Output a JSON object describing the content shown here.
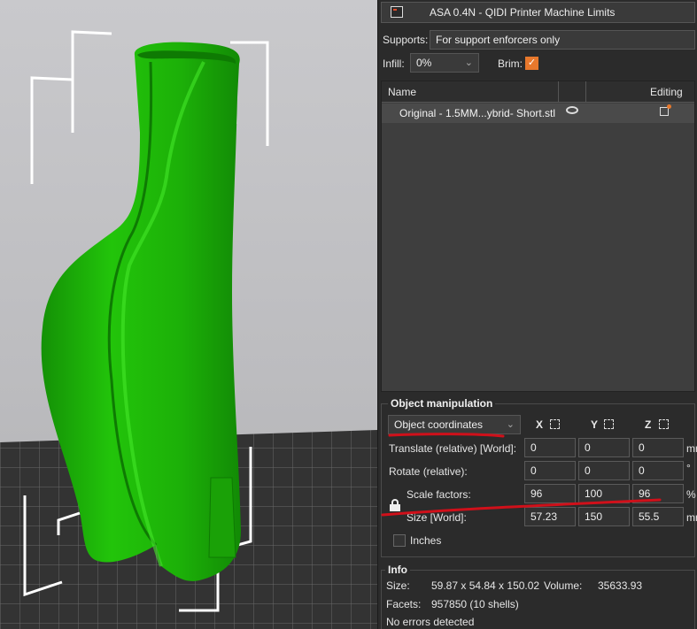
{
  "window": {
    "title": "ASA 0.4N - QIDI Printer Machine Limits"
  },
  "print_settings": {
    "supports_label": "Supports:",
    "supports_value": "For support enforcers only",
    "infill_label": "Infill:",
    "infill_value": "0%",
    "brim_label": "Brim:",
    "brim_checked": true
  },
  "object_list": {
    "col_name": "Name",
    "col_editing": "Editing",
    "items": [
      {
        "name": "Original - 1.5MM...ybrid- Short.stl"
      }
    ]
  },
  "object_manipulation": {
    "title": "Object manipulation",
    "coordinate_system": "Object coordinates",
    "axes": {
      "x": "X",
      "y": "Y",
      "z": "Z"
    },
    "rows": {
      "translate": {
        "label": "Translate (relative) [World]:",
        "x": "0",
        "y": "0",
        "z": "0",
        "unit": "mm"
      },
      "rotate": {
        "label": "Rotate (relative):",
        "x": "0",
        "y": "0",
        "z": "0",
        "unit": "°"
      },
      "scale": {
        "label": "Scale factors:",
        "x": "96",
        "y": "100",
        "z": "96",
        "unit": "%"
      },
      "size": {
        "label": "Size [World]:",
        "x": "57.23",
        "y": "150",
        "z": "55.5",
        "unit": "mm"
      }
    },
    "inches_label": "Inches"
  },
  "info": {
    "title": "Info",
    "size_label": "Size:",
    "size_value": "59.87 x 54.84 x 150.02",
    "volume_label": "Volume:",
    "volume_value": "35633.93",
    "facets_label": "Facets:",
    "facets_value": "957850 (10 shells)",
    "errors": "No errors detected"
  },
  "colors": {
    "model_green": "#22c40a",
    "brim_orange": "#e8782c",
    "annotation_red": "#d0101a"
  }
}
